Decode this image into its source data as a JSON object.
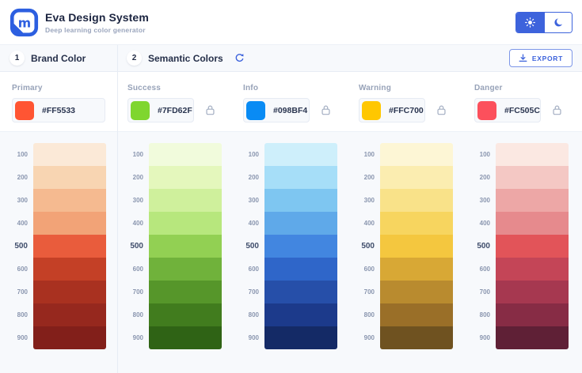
{
  "header": {
    "title": "Eva Design System",
    "subtitle": "Deep learning color generator",
    "logo_letter": "m"
  },
  "theme": {
    "active": "light"
  },
  "toolbar": {
    "brand_step": "1",
    "brand_title": "Brand Color",
    "semantic_step": "2",
    "semantic_title": "Semantic Colors",
    "export_label": "EXPORT"
  },
  "colors": {
    "accent": "#3D63DC",
    "panel_bg": "#F7F9FC",
    "border": "#E7ECF4"
  },
  "scale_steps": [
    "100",
    "200",
    "300",
    "400",
    "500",
    "600",
    "700",
    "800",
    "900"
  ],
  "palettes": [
    {
      "key": "primary",
      "name": "Primary",
      "hex": "#FF5533",
      "lockable": false,
      "shades": [
        "#FBE9D7",
        "#F8D5B2",
        "#F5BA90",
        "#F2A377",
        "#E95C3C",
        "#C44026",
        "#A93120",
        "#96281E",
        "#821F1A"
      ]
    },
    {
      "key": "success",
      "name": "Success",
      "hex": "#7FD62F",
      "lockable": true,
      "shades": [
        "#F1FBDC",
        "#E4F7BC",
        "#CFF09C",
        "#B7E77D",
        "#92D053",
        "#70B23B",
        "#56962A",
        "#417C1E",
        "#2F6315"
      ]
    },
    {
      "key": "info",
      "name": "Info",
      "hex": "#098BF4",
      "lockable": true,
      "shades": [
        "#CEEFFB",
        "#A6DEF8",
        "#7EC6F1",
        "#5FA9E9",
        "#4286E0",
        "#2F66C9",
        "#264FA9",
        "#1C3A8B",
        "#142A66"
      ]
    },
    {
      "key": "warning",
      "name": "Warning",
      "hex": "#FFC700",
      "lockable": true,
      "shades": [
        "#FDF6D5",
        "#FBEDB0",
        "#F9E289",
        "#F7D55F",
        "#F4C73F",
        "#D8A835",
        "#B98B2F",
        "#9A6F28",
        "#6F5220"
      ]
    },
    {
      "key": "danger",
      "name": "Danger",
      "hex": "#FC505C",
      "lockable": true,
      "shades": [
        "#FBE8E2",
        "#F4C8C4",
        "#EDA7A6",
        "#E68A8D",
        "#E25459",
        "#C44557",
        "#A63850",
        "#872C45",
        "#5F2036"
      ]
    }
  ]
}
